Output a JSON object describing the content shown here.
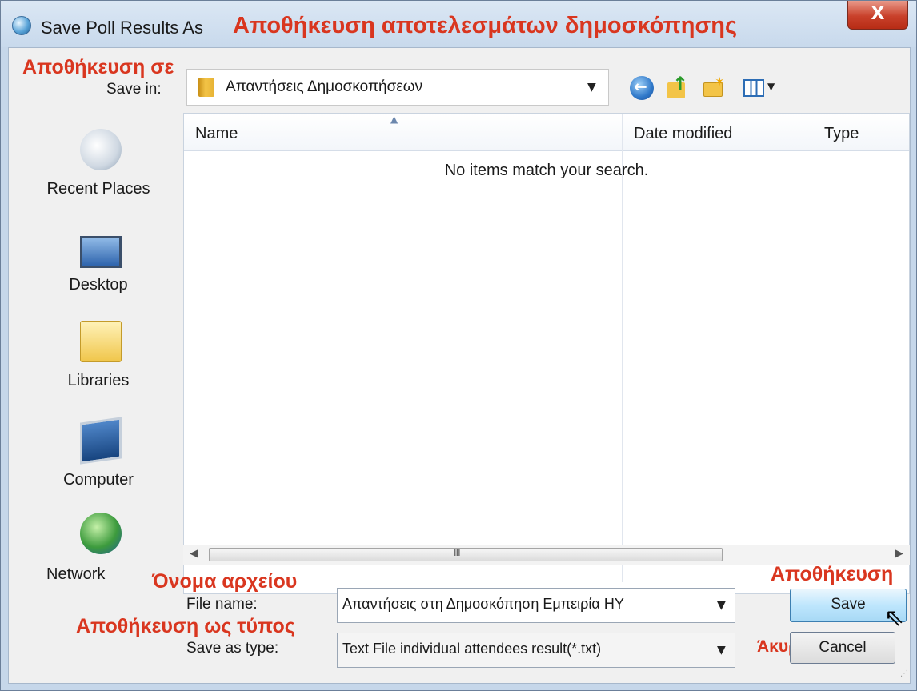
{
  "window": {
    "title": "Save Poll Results As",
    "title_annotation": "Αποθήκευση αποτελεσμάτων δημοσκόπησης",
    "close_label": "X"
  },
  "save_in": {
    "annotation": "Αποθήκευση σε",
    "label": "Save in:",
    "value": "Απαντήσεις Δημοσκοπήσεων"
  },
  "toolbar": {
    "icons": [
      "back-icon",
      "up-folder-icon",
      "new-folder-icon",
      "views-menu-icon"
    ]
  },
  "places": [
    {
      "label": "Recent Places",
      "icon": "recent-places-icon"
    },
    {
      "label": "Desktop",
      "icon": "desktop-icon"
    },
    {
      "label": "Libraries",
      "icon": "libraries-icon"
    },
    {
      "label": "Computer",
      "icon": "computer-icon"
    },
    {
      "label": "Network",
      "icon": "network-icon"
    }
  ],
  "filelist": {
    "columns": [
      "Name",
      "Date modified",
      "Type"
    ],
    "empty_message": "No items match your search.",
    "scrollbar_grip": "III"
  },
  "file_name": {
    "annotation": "Όνομα αρχείου",
    "label": "File name:",
    "value": "Απαντήσεις στη Δημοσκόπηση Εμπειρία ΗΥ"
  },
  "save_as_type": {
    "annotation": "Αποθήκευση ως τύπος",
    "label": "Save as type:",
    "value": "Text File individual attendees result(*.txt)"
  },
  "buttons": {
    "save_annotation": "Αποθήκευση",
    "save_label": "Save",
    "cancel_annotation": "Άκυρο",
    "cancel_label": "Cancel"
  },
  "colors": {
    "annotation": "#d9361f",
    "title_bar": "#c8d9ec",
    "close_button": "#c9412b",
    "save_button": "#bee6fd"
  }
}
